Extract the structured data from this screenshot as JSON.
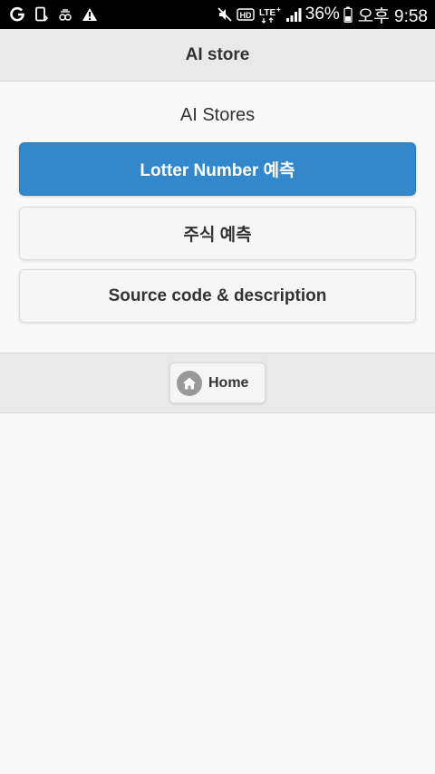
{
  "status_bar": {
    "battery_percent": "36%",
    "time": "오후 9:58",
    "network": "LTE+",
    "icons": [
      "g-app-icon",
      "phone-frame-icon",
      "recycle-icon",
      "warning-icon",
      "mute-icon",
      "hd-icon",
      "lte-plus-icon",
      "signal-icon",
      "battery-icon"
    ]
  },
  "header": {
    "title": "AI store"
  },
  "main": {
    "heading": "AI Stores",
    "buttons": [
      {
        "label": "Lotter Number 예측",
        "style": "primary"
      },
      {
        "label": "주식 예측",
        "style": "default"
      },
      {
        "label": "Source code & description",
        "style": "default"
      }
    ]
  },
  "footer": {
    "home_label": "Home",
    "home_icon": "home-icon"
  },
  "colors": {
    "primary": "#3388cc",
    "header_bg": "#e9e9e9",
    "page_bg": "#f9f9f9",
    "status_bar_bg": "#000000"
  }
}
